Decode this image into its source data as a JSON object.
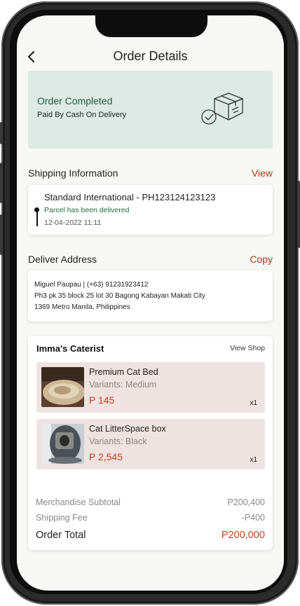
{
  "header": {
    "back_icon": "chevron-left-icon",
    "title": "Order Details"
  },
  "status": {
    "title": "Order Completed",
    "subtitle": "Paid By Cash On Delivery",
    "icon": "package-delivered-icon",
    "bg_color": "#dde9e4"
  },
  "shipping": {
    "section_title": "Shipping Information",
    "action_label": "View",
    "method": "Standard International - PH123124123123",
    "status": "Parcel has been delivered",
    "date": "12-04-2022 11:11"
  },
  "address": {
    "section_title": "Deliver Address",
    "action_label": "Copy",
    "lines": [
      "Miguel Paupau | (+63) 91231923412",
      "Ph3 pk 35 block 25 lot 30 Bagong Kabayan Makati City",
      "1369 Metro Manila, Philippines"
    ]
  },
  "shop": {
    "name": "Imma's Caterist",
    "view_shop_label": "View Shop",
    "products": [
      {
        "name": "Premium Cat Bed",
        "variant": "Variants: Medium",
        "price": "P 145",
        "qty": "x1"
      },
      {
        "name": "Cat LitterSpace box",
        "variant": "Variants: Black",
        "price": "P 2,545",
        "qty": "x1"
      }
    ]
  },
  "summary": {
    "subtotal_label": "Merchandise Subtotal",
    "subtotal_value": "P200,400",
    "shipping_label": "Shipping Fee",
    "shipping_value": "-P400",
    "total_label": "Order Total",
    "total_value": "P200,000"
  },
  "colors": {
    "accent": "#a33a1c",
    "price": "#c0441e",
    "success": "#1d6e3a",
    "product_bg": "#eee3e0"
  }
}
